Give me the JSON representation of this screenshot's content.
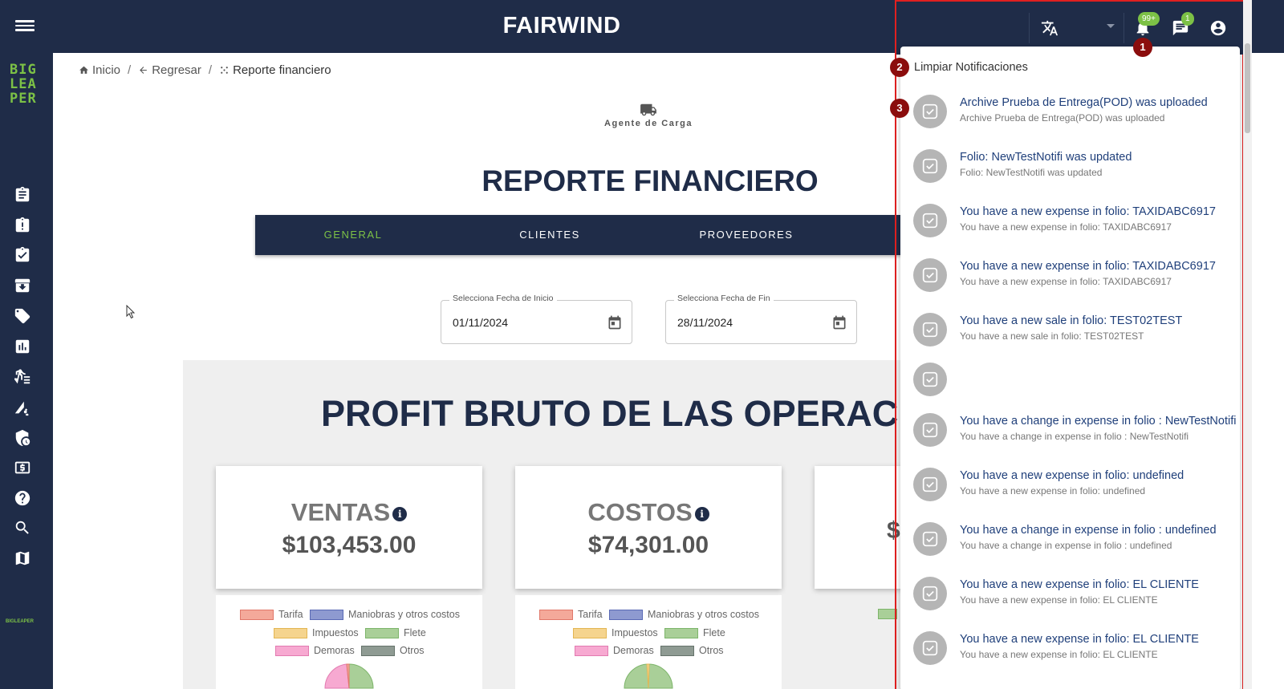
{
  "app": {
    "title": "FAIRWIND"
  },
  "sidebar": {
    "logo": [
      "BIG",
      "LEA",
      "PER"
    ],
    "small_brand": "BIGLEAPER",
    "items": [
      "clipboard-icon",
      "clipboard-alert-icon",
      "clipboard-check-icon",
      "archive-icon",
      "tag-icon",
      "bar-chart-icon",
      "walking-list-icon",
      "road-settings-icon",
      "shield-clock-icon",
      "cash-icon",
      "help-icon",
      "search-icon",
      "map-icon"
    ]
  },
  "breadcrumb": {
    "home": "Inicio",
    "back": "Regresar",
    "current": "Reporte financiero"
  },
  "page": {
    "agent_label": "Agente de Carga",
    "title": "REPORTE FINANCIERO",
    "tabs": [
      {
        "label": "GENERAL",
        "active": true
      },
      {
        "label": "CLIENTES",
        "active": false
      },
      {
        "label": "PROVEEDORES",
        "active": false
      }
    ],
    "start_date": {
      "label": "Selecciona Fecha de Inicio",
      "value": "01/11/2024"
    },
    "end_date": {
      "label": "Selecciona Fecha de Fin",
      "value": "28/11/2024"
    },
    "profit_title": "PROFIT BRUTO DE LAS OPERACIONES",
    "cards": [
      {
        "title": "VENTAS",
        "value": "$103,453.00"
      },
      {
        "title": "COSTOS",
        "value": "$74,301.00"
      },
      {
        "title": "",
        "value": "$"
      }
    ],
    "legend": [
      {
        "label": "Tarifa",
        "color": "#f4a99a",
        "border": "#e0786a"
      },
      {
        "label": "Maniobras y otros costos",
        "color": "#8e9ad0",
        "border": "#5a6ab5"
      },
      {
        "label": "Impuestos",
        "color": "#f5d48e",
        "border": "#e3b653"
      },
      {
        "label": "Flete",
        "color": "#a9cf98",
        "border": "#7db56a"
      },
      {
        "label": "Demoras",
        "color": "#f7a9d1",
        "border": "#e27ab0"
      },
      {
        "label": "Otros",
        "color": "#8f9b93",
        "border": "#66736b"
      }
    ]
  },
  "notifications": {
    "bell_badge": "99+",
    "chat_badge": "1",
    "clear_label": "Limpiar Notificaciones",
    "markers": [
      "1",
      "2",
      "3"
    ],
    "items": [
      {
        "title": "Archive Prueba de Entrega(POD) was uploaded",
        "body": "Archive Prueba de Entrega(POD) was uploaded"
      },
      {
        "title": "Folio: NewTestNotifi was updated",
        "body": "Folio: NewTestNotifi was updated"
      },
      {
        "title": "You have a new expense in folio: TAXIDABC6917",
        "body": "You have a new expense in folio: TAXIDABC6917"
      },
      {
        "title": "You have a new expense in folio: TAXIDABC6917",
        "body": "You have a new expense in folio: TAXIDABC6917"
      },
      {
        "title": "You have a new sale in folio: TEST02TEST",
        "body": "You have a new sale in folio: TEST02TEST"
      },
      {
        "title": "",
        "body": ""
      },
      {
        "title": "You have a change in expense in folio : NewTestNotifi",
        "body": "You have a change in expense in folio : NewTestNotifi"
      },
      {
        "title": "You have a new expense in folio: undefined",
        "body": "You have a new expense in folio: undefined"
      },
      {
        "title": "You have a change in expense in folio : undefined",
        "body": "You have a change in expense in folio : undefined"
      },
      {
        "title": "You have a new expense in folio: EL CLIENTE",
        "body": "You have a new expense in folio: EL CLIENTE"
      },
      {
        "title": "You have a new expense in folio: EL CLIENTE",
        "body": "You have a new expense in folio: EL CLIENTE"
      }
    ]
  }
}
